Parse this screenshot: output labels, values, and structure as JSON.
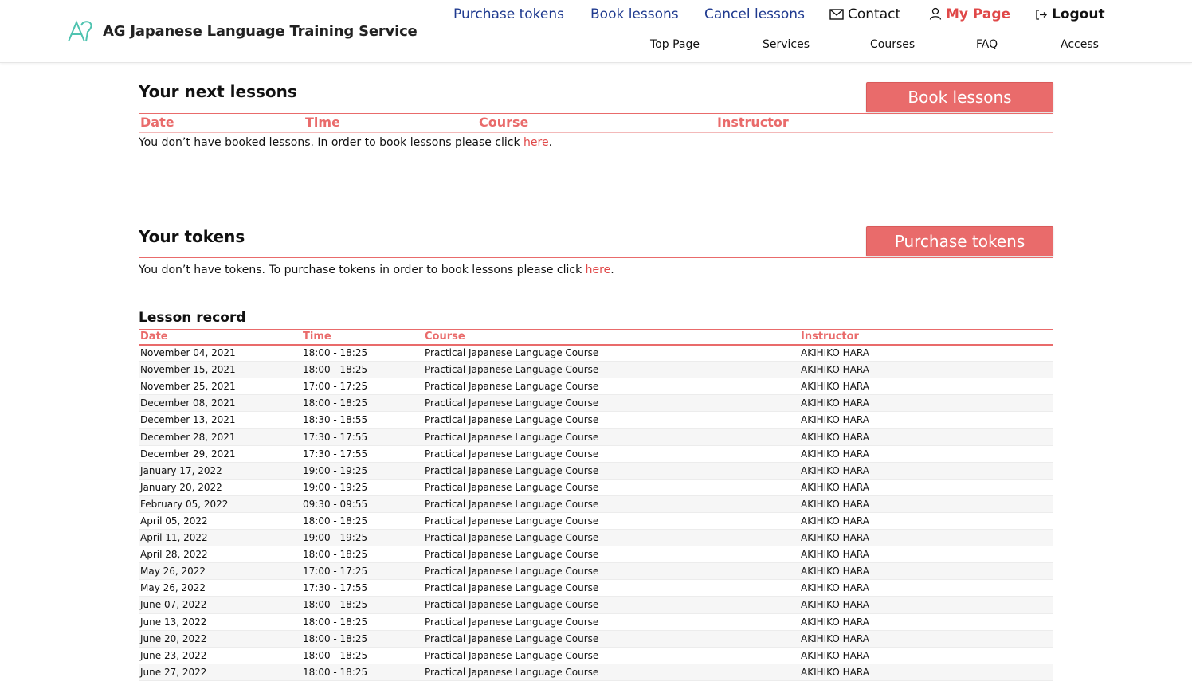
{
  "brand": {
    "name": "AG Japanese Language Training Service",
    "accent": "#e96b6b",
    "logo_color": "#4fc3b0"
  },
  "topnav": {
    "purchase_tokens": "Purchase tokens",
    "book_lessons": "Book lessons",
    "cancel_lessons": "Cancel lessons",
    "contact": "Contact",
    "my_page": "My Page",
    "logout": "Logout"
  },
  "subnav": {
    "top_page": "Top Page",
    "services": "Services",
    "courses": "Courses",
    "faq": "FAQ",
    "access": "Access"
  },
  "next_lessons": {
    "title": "Your next lessons",
    "button": "Book lessons",
    "columns": [
      "Date",
      "Time",
      "Course",
      "Instructor"
    ],
    "empty_message": "You don’t have booked lessons. In order to book lessons please click ",
    "link": "here",
    "suffix": "."
  },
  "tokens": {
    "title": "Your tokens",
    "button": "Purchase tokens",
    "empty_message": "You don’t have tokens. To purchase tokens in order to book lessons please click ",
    "link": "here",
    "suffix": "."
  },
  "lesson_record": {
    "title": "Lesson record",
    "columns": [
      "Date",
      "Time",
      "Course",
      "Instructor"
    ],
    "rows": [
      [
        "November 04, 2021",
        "18:00 - 18:25",
        "Practical Japanese Language Course",
        "AKIHIKO HARA"
      ],
      [
        "November 15, 2021",
        "18:00 - 18:25",
        "Practical Japanese Language Course",
        "AKIHIKO HARA"
      ],
      [
        "November 25, 2021",
        "17:00 - 17:25",
        "Practical Japanese Language Course",
        "AKIHIKO HARA"
      ],
      [
        "December 08, 2021",
        "18:00 - 18:25",
        "Practical Japanese Language Course",
        "AKIHIKO HARA"
      ],
      [
        "December 13, 2021",
        "18:30 - 18:55",
        "Practical Japanese Language Course",
        "AKIHIKO HARA"
      ],
      [
        "December 28, 2021",
        "17:30 - 17:55",
        "Practical Japanese Language Course",
        "AKIHIKO HARA"
      ],
      [
        "December 29, 2021",
        "17:30 - 17:55",
        "Practical Japanese Language Course",
        "AKIHIKO HARA"
      ],
      [
        "January 17, 2022",
        "19:00 - 19:25",
        "Practical Japanese Language Course",
        "AKIHIKO HARA"
      ],
      [
        "January 20, 2022",
        "19:00 - 19:25",
        "Practical Japanese Language Course",
        "AKIHIKO HARA"
      ],
      [
        "February 05, 2022",
        "09:30 - 09:55",
        "Practical Japanese Language Course",
        "AKIHIKO HARA"
      ],
      [
        "April 05, 2022",
        "18:00 - 18:25",
        "Practical Japanese Language Course",
        "AKIHIKO HARA"
      ],
      [
        "April 11, 2022",
        "19:00 - 19:25",
        "Practical Japanese Language Course",
        "AKIHIKO HARA"
      ],
      [
        "April 28, 2022",
        "18:00 - 18:25",
        "Practical Japanese Language Course",
        "AKIHIKO HARA"
      ],
      [
        "May 26, 2022",
        "17:00 - 17:25",
        "Practical Japanese Language Course",
        "AKIHIKO HARA"
      ],
      [
        "May 26, 2022",
        "17:30 - 17:55",
        "Practical Japanese Language Course",
        "AKIHIKO HARA"
      ],
      [
        "June 07, 2022",
        "18:00 - 18:25",
        "Practical Japanese Language Course",
        "AKIHIKO HARA"
      ],
      [
        "June 13, 2022",
        "18:00 - 18:25",
        "Practical Japanese Language Course",
        "AKIHIKO HARA"
      ],
      [
        "June 20, 2022",
        "18:00 - 18:25",
        "Practical Japanese Language Course",
        "AKIHIKO HARA"
      ],
      [
        "June 23, 2022",
        "18:00 - 18:25",
        "Practical Japanese Language Course",
        "AKIHIKO HARA"
      ],
      [
        "June 27, 2022",
        "18:00 - 18:25",
        "Practical Japanese Language Course",
        "AKIHIKO HARA"
      ]
    ]
  }
}
